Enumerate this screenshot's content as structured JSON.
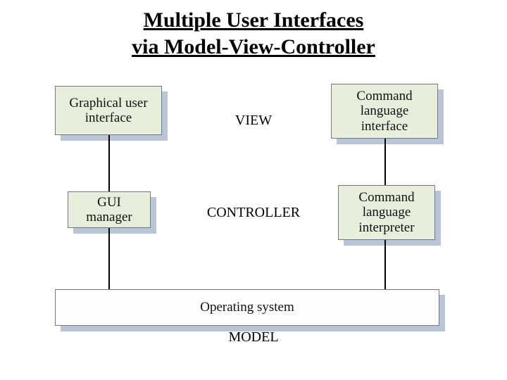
{
  "title_line1": "Multiple User Interfaces",
  "title_line2": "via Model-View-Controller",
  "row_labels": {
    "view": "VIEW",
    "controller": "CONTROLLER",
    "model": "MODEL"
  },
  "boxes": {
    "gui": "Graphical user\ninterface",
    "cmd_if": "Command\nlanguage\ninterface",
    "gui_mgr": "GUI\nmanager",
    "cmd_interp": "Command\nlanguage\ninterpreter",
    "os": "Operating system"
  }
}
